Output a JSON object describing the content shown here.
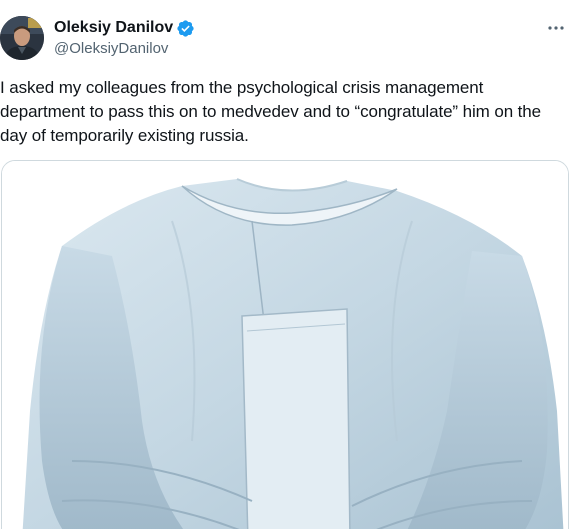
{
  "author": {
    "display_name": "Oleksiy Danilov",
    "handle": "@OleksiyDanilov",
    "verified": true,
    "verified_color": "#1d9bf0"
  },
  "tweet": {
    "text": "I asked my colleagues from the psychological crisis management department to pass this on to medvedev and to “congratulate” him on the day of temporarily existing russia."
  },
  "icons": {
    "verified": "verified-badge-icon",
    "more": "more-options-icon"
  },
  "colors": {
    "text_primary": "#0f1419",
    "text_secondary": "#536471",
    "border": "#cfd9de",
    "garment": "#c9dbe6"
  }
}
